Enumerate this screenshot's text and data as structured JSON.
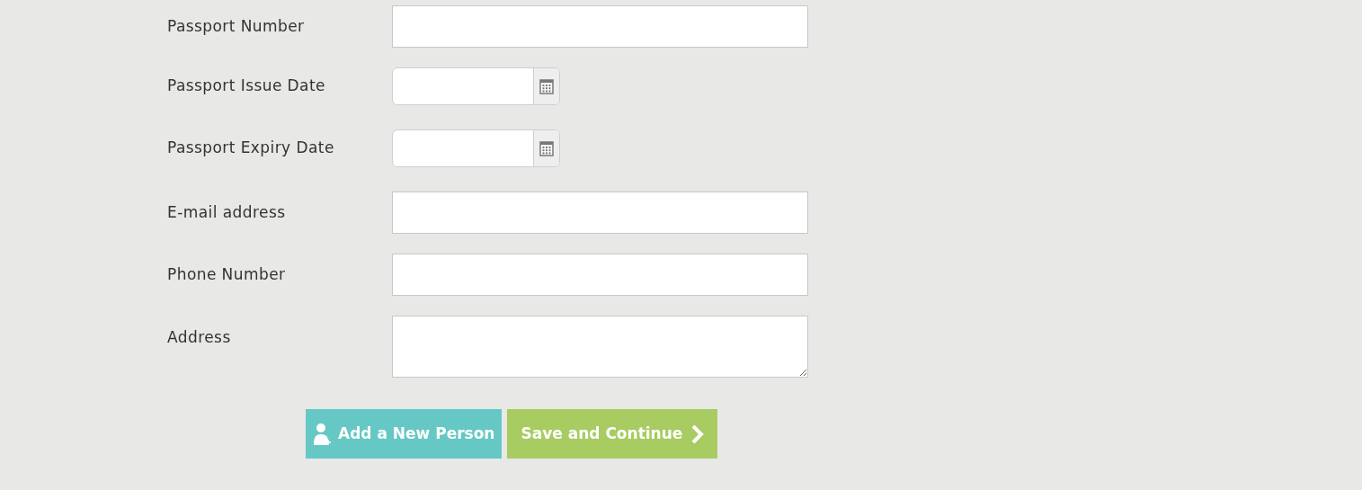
{
  "fields": [
    {
      "label": "Passport Number",
      "kind": "text"
    },
    {
      "label": "Passport Issue Date",
      "kind": "date"
    },
    {
      "label": "Passport Expiry Date",
      "kind": "date"
    },
    {
      "label": "E-mail address",
      "kind": "text"
    },
    {
      "label": "Phone Number",
      "kind": "text"
    },
    {
      "label": "Address",
      "kind": "textarea"
    }
  ],
  "buttons": [
    {
      "label": "Add a New Person",
      "kind": "add"
    },
    {
      "label": "Save and Continue",
      "kind": "continue"
    }
  ]
}
